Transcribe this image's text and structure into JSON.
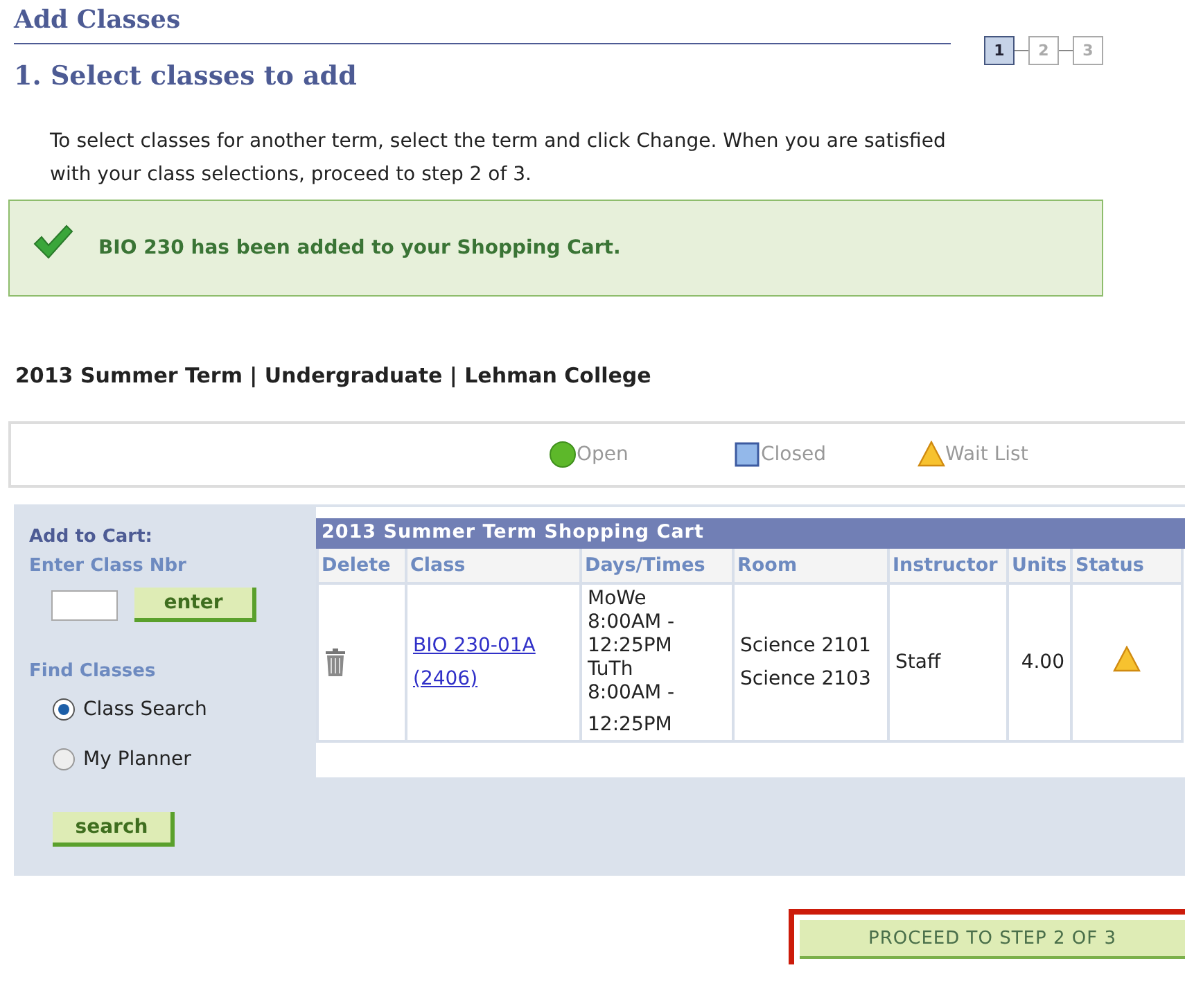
{
  "page_title": "Add Classes",
  "steps": [
    {
      "label": "1",
      "selected": true
    },
    {
      "label": "2",
      "selected": false
    },
    {
      "label": "3",
      "selected": false
    }
  ],
  "section_title": "1.  Select classes to add",
  "instructions": "To select classes for another term, select the term and click Change.  When you are satisfied with your class selections, proceed to step 2 of 3.",
  "success_message": "BIO  230 has been added to your Shopping Cart.",
  "term_info": "2013 Summer Term | Undergraduate | Lehman College",
  "legend": [
    {
      "kind": "open",
      "label": "Open"
    },
    {
      "kind": "closed",
      "label": "Closed"
    },
    {
      "kind": "waitlist",
      "label": "Wait List"
    }
  ],
  "add_panel": {
    "title": "Add to Cart:",
    "class_nbr_label": "Enter Class Nbr",
    "enter_button": "enter",
    "find_label": "Find Classes",
    "options": [
      {
        "label": "Class Search",
        "selected": true
      },
      {
        "label": "My Planner",
        "selected": false
      }
    ],
    "search_button": "search"
  },
  "cart": {
    "title": "2013 Summer Term Shopping Cart",
    "columns": [
      "Delete",
      "Class",
      "Days/Times",
      "Room",
      "Instructor",
      "Units",
      "Status"
    ],
    "rows": [
      {
        "class_lines": [
          "BIO 230-01A",
          "(2406)"
        ],
        "days_times": [
          "MoWe",
          "8:00AM -",
          "12:25PM",
          "TuTh",
          "8:00AM -",
          "12:25PM"
        ],
        "rooms": [
          "Science 2101",
          "Science 2103"
        ],
        "instructor": "Staff",
        "units": "4.00",
        "kind": "waitlist"
      }
    ]
  },
  "proceed_button": "PROCEED TO STEP 2 OF 3"
}
